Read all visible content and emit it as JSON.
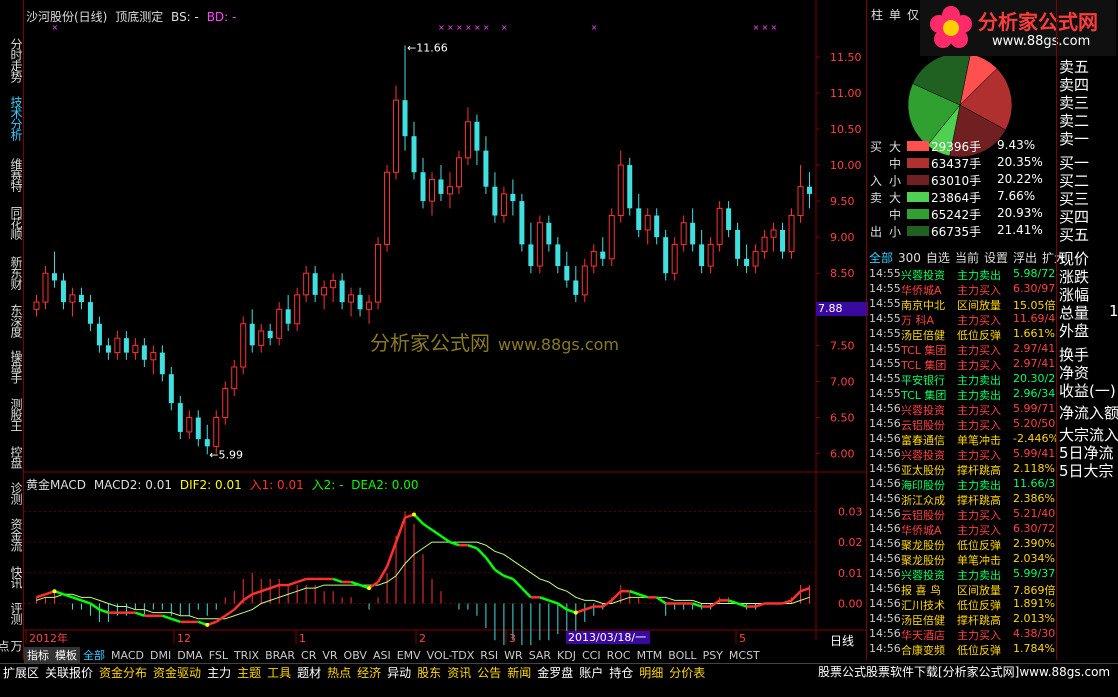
{
  "title": {
    "stock": "沙河股份(日线)",
    "indicator": "顶底测定",
    "bs": "BS: -",
    "bd": "BD: -"
  },
  "left_tabs": [
    {
      "label": "分时走势",
      "active": false
    },
    {
      "label": "技术分析",
      "active": true
    },
    {
      "label": "维赛特",
      "active": false
    },
    {
      "label": "同花顺",
      "active": false
    },
    {
      "label": "新东财",
      "active": false
    },
    {
      "label": "东深度",
      "active": false
    },
    {
      "label": "操盘手",
      "active": false
    },
    {
      "label": "测股王",
      "active": false
    },
    {
      "label": "控盘",
      "active": false
    },
    {
      "label": "诊测",
      "active": false
    },
    {
      "label": "资金流",
      "active": false
    },
    {
      "label": "快讯",
      "active": false
    },
    {
      "label": "评测",
      "active": false
    },
    {
      "label": "万点",
      "active": false
    }
  ],
  "price_axis": [
    "11.50",
    "11.00",
    "10.50",
    "10.00",
    "9.50",
    "9.00",
    "8.50",
    "8.00",
    "7.50",
    "7.00",
    "6.50",
    "6.00"
  ],
  "price_marker": "7.88",
  "annotations": {
    "high": "11.66",
    "low": "5.99"
  },
  "macd_legend": {
    "name": "黄金MACD",
    "macd2": "MACD2: 0.01",
    "dif2": "DIF2: 0.01",
    "in1": "入1: 0.01",
    "in2": "入2: -",
    "dea2": "DEA2: 0.00"
  },
  "macd_axis": [
    "0.03",
    "0.02",
    "0.01",
    "0.00"
  ],
  "watermark": {
    "brand": "分析家公式网",
    "url": "www.88gs.com"
  },
  "time_axis": [
    "2012年",
    "12",
    "1",
    "2",
    "3",
    "5"
  ],
  "date_box": "2013/03/18/一",
  "period": "日线",
  "logo": {
    "brand": "分析家公式网",
    "site": "www.88gs.com"
  },
  "right_header": [
    "柱",
    "单",
    "仅"
  ],
  "flow": [
    {
      "side": "买",
      "size": "大",
      "color": "#ff5050",
      "vol": "29396手",
      "pct": "9.43%"
    },
    {
      "side": "",
      "size": "中",
      "color": "#b03030",
      "vol": "63437手",
      "pct": "20.35%"
    },
    {
      "side": "入",
      "size": "小",
      "color": "#702020",
      "vol": "63010手",
      "pct": "20.22%"
    },
    {
      "side": "卖",
      "size": "大",
      "color": "#50d050",
      "vol": "23864手",
      "pct": "7.66%"
    },
    {
      "side": "",
      "size": "中",
      "color": "#30a030",
      "vol": "65242手",
      "pct": "20.93%"
    },
    {
      "side": "出",
      "size": "小",
      "color": "#206020",
      "vol": "66735手",
      "pct": "21.41%"
    }
  ],
  "right_tabs": [
    "全部",
    "300",
    "自选",
    "当前",
    "设置",
    "浮出",
    "扩大"
  ],
  "ticker": [
    {
      "t": "14:55",
      "name": "兴蓉投资",
      "act": "主力卖出",
      "val": "5.98/72"
    },
    {
      "t": "14:55",
      "name": "华侨城A",
      "act": "主力买入",
      "val": "6.30/97"
    },
    {
      "t": "14:55",
      "name": "南京中北",
      "act": "区间放量",
      "val": "15.05倍"
    },
    {
      "t": "14:55",
      "name": "万  科A",
      "act": "主力买入",
      "val": "11.69/4"
    },
    {
      "t": "14:55",
      "name": "汤臣倍健",
      "act": "低位反弹",
      "val": "1.661%"
    },
    {
      "t": "14:55",
      "name": "TCL 集团",
      "act": "主力买入",
      "val": "2.97/41"
    },
    {
      "t": "14:55",
      "name": "TCL 集团",
      "act": "主力买入",
      "val": "2.97/41"
    },
    {
      "t": "14:55",
      "name": "平安银行",
      "act": "主力卖出",
      "val": "20.30/2"
    },
    {
      "t": "14:55",
      "name": "TCL 集团",
      "act": "主力卖出",
      "val": "2.96/34"
    },
    {
      "t": "14:56",
      "name": "兴蓉投资",
      "act": "主力买入",
      "val": "5.99/71"
    },
    {
      "t": "14:56",
      "name": "云铝股份",
      "act": "主力买入",
      "val": "5.20/50"
    },
    {
      "t": "14:56",
      "name": "富春通信",
      "act": "单笔冲击",
      "val": "-2.446%"
    },
    {
      "t": "14:56",
      "name": "兴蓉投资",
      "act": "主力买入",
      "val": "5.99/41"
    },
    {
      "t": "14:56",
      "name": "亚太股份",
      "act": "撑杆跳高",
      "val": "2.118%"
    },
    {
      "t": "14:56",
      "name": "海印股份",
      "act": "主力卖出",
      "val": "11.66/30"
    },
    {
      "t": "14:56",
      "name": "浙江众成",
      "act": "撑杆跳高",
      "val": "2.386%"
    },
    {
      "t": "14:56",
      "name": "云铝股份",
      "act": "主力买入",
      "val": "5.21/40"
    },
    {
      "t": "14:56",
      "name": "华侨城A",
      "act": "主力买入",
      "val": "6.30/72"
    },
    {
      "t": "14:56",
      "name": "聚龙股份",
      "act": "低位反弹",
      "val": "2.390%"
    },
    {
      "t": "14:56",
      "name": "聚龙股份",
      "act": "单笔冲击",
      "val": "2.034%"
    },
    {
      "t": "14:56",
      "name": "兴蓉投资",
      "act": "主力卖出",
      "val": "5.99/37"
    },
    {
      "t": "14:56",
      "name": "报 喜 鸟",
      "act": "区间放量",
      "val": "7.869倍"
    },
    {
      "t": "14:56",
      "name": "汇川技术",
      "act": "低位反弹",
      "val": "1.891%"
    },
    {
      "t": "14:56",
      "name": "汤臣倍健",
      "act": "撑杆跳高",
      "val": "2.013%"
    },
    {
      "t": "14:56",
      "name": "华天酒店",
      "act": "主力买入",
      "val": "4.38/30"
    },
    {
      "t": "14:56",
      "name": "合康变频",
      "act": "低位反弹",
      "val": "1.784%"
    }
  ],
  "far_right": [
    "卖五",
    "卖四",
    "卖三",
    "卖二",
    "卖一",
    "买一",
    "买二",
    "买三",
    "买四",
    "买五",
    "现价",
    "涨跌",
    "涨幅",
    "总量",
    "外盘",
    "换手",
    "净资",
    "收益(一)",
    "净流入额",
    "大宗流入",
    "5日净流",
    "5日大宗"
  ],
  "far_right_extra": "1",
  "indicator_bar": [
    "指标",
    "模板",
    "全部",
    "MACD",
    "DMI",
    "DMA",
    "FSL",
    "TRIX",
    "BRAR",
    "CR",
    "VR",
    "OBV",
    "ASI",
    "EMV",
    "VOL-TDX",
    "RSI",
    "WR",
    "SAR",
    "KDJ",
    "CCI",
    "ROC",
    "MTM",
    "BOLL",
    "PSY",
    "MCST"
  ],
  "nav_bar": [
    {
      "label": "扩展区",
      "color": "#ffffff"
    },
    {
      "label": "关联报价",
      "color": "#ffffff"
    },
    {
      "label": "资金分布",
      "color": "#ffd700"
    },
    {
      "label": "资金驱动",
      "color": "#ffd700"
    },
    {
      "label": "主力",
      "color": "#ffffff"
    },
    {
      "label": "主题",
      "color": "#ffd700"
    },
    {
      "label": "工具",
      "color": "#ffd700"
    },
    {
      "label": "题材",
      "color": "#ffffff"
    },
    {
      "label": "热点",
      "color": "#ffd700"
    },
    {
      "label": "经济",
      "color": "#ffd700"
    },
    {
      "label": "异动",
      "color": "#ffffff"
    },
    {
      "label": "股东",
      "color": "#ffd700"
    },
    {
      "label": "资讯",
      "color": "#ffd700"
    },
    {
      "label": "公告",
      "color": "#ffd700"
    },
    {
      "label": "新闻",
      "color": "#ffd700"
    },
    {
      "label": "金罗盘",
      "color": "#ffffff"
    },
    {
      "label": "账户",
      "color": "#ffffff"
    },
    {
      "label": "持仓",
      "color": "#ffffff"
    },
    {
      "label": "明细",
      "color": "#ffd700"
    },
    {
      "label": "分价表",
      "color": "#ffd700"
    }
  ],
  "status_right": "股票公式股票软件下载[分析家公式网]www.88gs.com",
  "colors": {
    "up": "#ff3030",
    "down": "#40e0e0",
    "axis": "#800000",
    "grid": "#500000",
    "macd_dif": "#00ff00",
    "macd_dea": "#ffff00"
  },
  "chart_data": {
    "type": "candlestick",
    "ylim": [
      5.8,
      11.9
    ],
    "candles": [
      [
        8.0,
        8.2,
        7.9,
        8.1
      ],
      [
        8.1,
        8.6,
        8.0,
        8.5
      ],
      [
        8.5,
        8.8,
        8.3,
        8.4
      ],
      [
        8.4,
        8.5,
        8.0,
        8.1
      ],
      [
        8.1,
        8.3,
        7.9,
        8.2
      ],
      [
        8.2,
        8.3,
        8.0,
        8.1
      ],
      [
        8.1,
        8.2,
        7.7,
        7.8
      ],
      [
        7.8,
        7.9,
        7.4,
        7.5
      ],
      [
        7.5,
        7.6,
        7.3,
        7.4
      ],
      [
        7.4,
        7.7,
        7.3,
        7.6
      ],
      [
        7.6,
        7.7,
        7.3,
        7.4
      ],
      [
        7.4,
        7.6,
        7.3,
        7.5
      ],
      [
        7.5,
        7.6,
        7.2,
        7.3
      ],
      [
        7.3,
        7.5,
        7.1,
        7.4
      ],
      [
        7.4,
        7.5,
        7.0,
        7.1
      ],
      [
        7.1,
        7.2,
        6.6,
        6.7
      ],
      [
        6.7,
        6.8,
        6.2,
        6.3
      ],
      [
        6.3,
        6.6,
        6.2,
        6.5
      ],
      [
        6.5,
        6.6,
        6.1,
        6.2
      ],
      [
        6.2,
        6.4,
        5.99,
        6.1
      ],
      [
        6.1,
        6.6,
        6.0,
        6.5
      ],
      [
        6.5,
        7.0,
        6.4,
        6.9
      ],
      [
        6.9,
        7.3,
        6.8,
        7.2
      ],
      [
        7.2,
        7.9,
        7.1,
        7.8
      ],
      [
        7.8,
        8.0,
        7.4,
        7.5
      ],
      [
        7.5,
        7.8,
        7.4,
        7.7
      ],
      [
        7.7,
        7.8,
        7.5,
        7.6
      ],
      [
        7.6,
        8.1,
        7.5,
        8.0
      ],
      [
        8.0,
        8.2,
        7.7,
        7.8
      ],
      [
        7.8,
        8.3,
        7.7,
        8.2
      ],
      [
        8.2,
        8.6,
        8.1,
        8.5
      ],
      [
        8.5,
        8.6,
        8.1,
        8.2
      ],
      [
        8.2,
        8.4,
        8.0,
        8.3
      ],
      [
        8.3,
        8.5,
        8.1,
        8.4
      ],
      [
        8.4,
        8.5,
        8.0,
        8.1
      ],
      [
        8.1,
        8.3,
        7.9,
        8.2
      ],
      [
        8.2,
        8.3,
        7.9,
        8.0
      ],
      [
        8.0,
        8.2,
        7.8,
        8.1
      ],
      [
        8.1,
        9.0,
        8.0,
        8.9
      ],
      [
        8.9,
        10.0,
        8.8,
        9.9
      ],
      [
        9.9,
        11.1,
        9.8,
        10.9
      ],
      [
        10.9,
        11.66,
        10.2,
        10.4
      ],
      [
        10.4,
        10.6,
        9.8,
        9.9
      ],
      [
        9.9,
        10.1,
        9.4,
        9.5
      ],
      [
        9.5,
        9.9,
        9.3,
        9.8
      ],
      [
        9.8,
        10.0,
        9.5,
        9.6
      ],
      [
        9.6,
        9.9,
        9.4,
        9.7
      ],
      [
        9.7,
        10.2,
        9.6,
        10.1
      ],
      [
        10.1,
        10.8,
        10.0,
        10.6
      ],
      [
        10.6,
        10.7,
        10.0,
        10.2
      ],
      [
        10.2,
        10.4,
        9.6,
        9.7
      ],
      [
        9.7,
        9.9,
        9.2,
        9.3
      ],
      [
        9.3,
        9.7,
        9.2,
        9.6
      ],
      [
        9.6,
        9.8,
        9.3,
        9.5
      ],
      [
        9.5,
        9.6,
        8.8,
        8.9
      ],
      [
        8.9,
        9.2,
        8.5,
        8.6
      ],
      [
        8.6,
        9.3,
        8.5,
        9.2
      ],
      [
        9.2,
        9.3,
        8.8,
        8.9
      ],
      [
        8.9,
        9.0,
        8.5,
        8.6
      ],
      [
        8.6,
        8.8,
        8.3,
        8.4
      ],
      [
        8.4,
        8.6,
        8.1,
        8.2
      ],
      [
        8.2,
        8.7,
        8.1,
        8.6
      ],
      [
        8.6,
        8.9,
        8.5,
        8.8
      ],
      [
        8.8,
        9.0,
        8.6,
        8.7
      ],
      [
        8.7,
        9.4,
        8.6,
        9.3
      ],
      [
        9.3,
        10.2,
        9.2,
        10.0
      ],
      [
        10.0,
        10.1,
        9.3,
        9.4
      ],
      [
        9.4,
        9.6,
        9.0,
        9.1
      ],
      [
        9.1,
        9.4,
        8.9,
        9.3
      ],
      [
        9.3,
        9.4,
        8.9,
        9.0
      ],
      [
        9.0,
        9.1,
        8.4,
        8.5
      ],
      [
        8.5,
        9.0,
        8.4,
        8.9
      ],
      [
        8.9,
        9.3,
        8.8,
        9.2
      ],
      [
        9.2,
        9.4,
        8.8,
        8.9
      ],
      [
        8.9,
        9.1,
        8.5,
        8.6
      ],
      [
        8.6,
        9.0,
        8.5,
        8.9
      ],
      [
        8.9,
        9.5,
        8.8,
        9.4
      ],
      [
        9.4,
        9.5,
        9.0,
        9.1
      ],
      [
        9.1,
        9.2,
        8.6,
        8.7
      ],
      [
        8.7,
        8.9,
        8.5,
        8.6
      ],
      [
        8.6,
        8.9,
        8.5,
        8.8
      ],
      [
        8.8,
        9.1,
        8.7,
        9.0
      ],
      [
        9.0,
        9.2,
        8.8,
        9.1
      ],
      [
        9.1,
        9.2,
        8.7,
        8.8
      ],
      [
        8.8,
        9.4,
        8.7,
        9.3
      ],
      [
        9.3,
        10.0,
        9.2,
        9.7
      ],
      [
        9.7,
        9.9,
        9.4,
        9.6
      ]
    ],
    "macd_ylim": [
      -0.008,
      0.037
    ],
    "dif": [
      0.002,
      0.003,
      0.004,
      0.003,
      0.002,
      0.001,
      0.0,
      -0.002,
      -0.003,
      -0.003,
      -0.003,
      -0.003,
      -0.004,
      -0.004,
      -0.004,
      -0.005,
      -0.006,
      -0.006,
      -0.006,
      -0.007,
      -0.006,
      -0.004,
      -0.002,
      0.001,
      0.003,
      0.004,
      0.005,
      0.006,
      0.006,
      0.007,
      0.008,
      0.008,
      0.008,
      0.008,
      0.007,
      0.007,
      0.006,
      0.005,
      0.007,
      0.012,
      0.02,
      0.028,
      0.029,
      0.026,
      0.024,
      0.022,
      0.02,
      0.019,
      0.019,
      0.018,
      0.015,
      0.011,
      0.009,
      0.008,
      0.005,
      0.002,
      0.002,
      0.001,
      0.0,
      -0.002,
      -0.003,
      -0.002,
      -0.001,
      -0.001,
      0.001,
      0.004,
      0.004,
      0.003,
      0.002,
      0.002,
      0.0,
      0.0,
      0.0,
      0.0,
      -0.001,
      -0.001,
      0.001,
      0.001,
      0.0,
      -0.001,
      -0.001,
      0.0,
      0.0,
      0.0,
      0.001,
      0.004,
      0.005
    ],
    "dea": [
      0.001,
      0.002,
      0.002,
      0.003,
      0.003,
      0.002,
      0.002,
      0.001,
      0.0,
      -0.001,
      -0.001,
      -0.002,
      -0.002,
      -0.003,
      -0.003,
      -0.003,
      -0.004,
      -0.004,
      -0.005,
      -0.005,
      -0.005,
      -0.005,
      -0.004,
      -0.003,
      -0.002,
      0.0,
      0.001,
      0.002,
      0.003,
      0.004,
      0.005,
      0.005,
      0.006,
      0.006,
      0.006,
      0.006,
      0.006,
      0.006,
      0.006,
      0.007,
      0.009,
      0.013,
      0.016,
      0.018,
      0.02,
      0.02,
      0.02,
      0.02,
      0.02,
      0.02,
      0.019,
      0.017,
      0.016,
      0.014,
      0.012,
      0.01,
      0.008,
      0.007,
      0.005,
      0.004,
      0.002,
      0.001,
      0.001,
      0.0,
      0.0,
      0.001,
      0.002,
      0.002,
      0.002,
      0.002,
      0.002,
      0.001,
      0.001,
      0.001,
      0.0,
      0.0,
      0.0,
      0.0,
      0.0,
      0.0,
      0.0,
      0.0,
      0.0,
      0.0,
      0.0,
      0.001,
      0.002
    ]
  }
}
